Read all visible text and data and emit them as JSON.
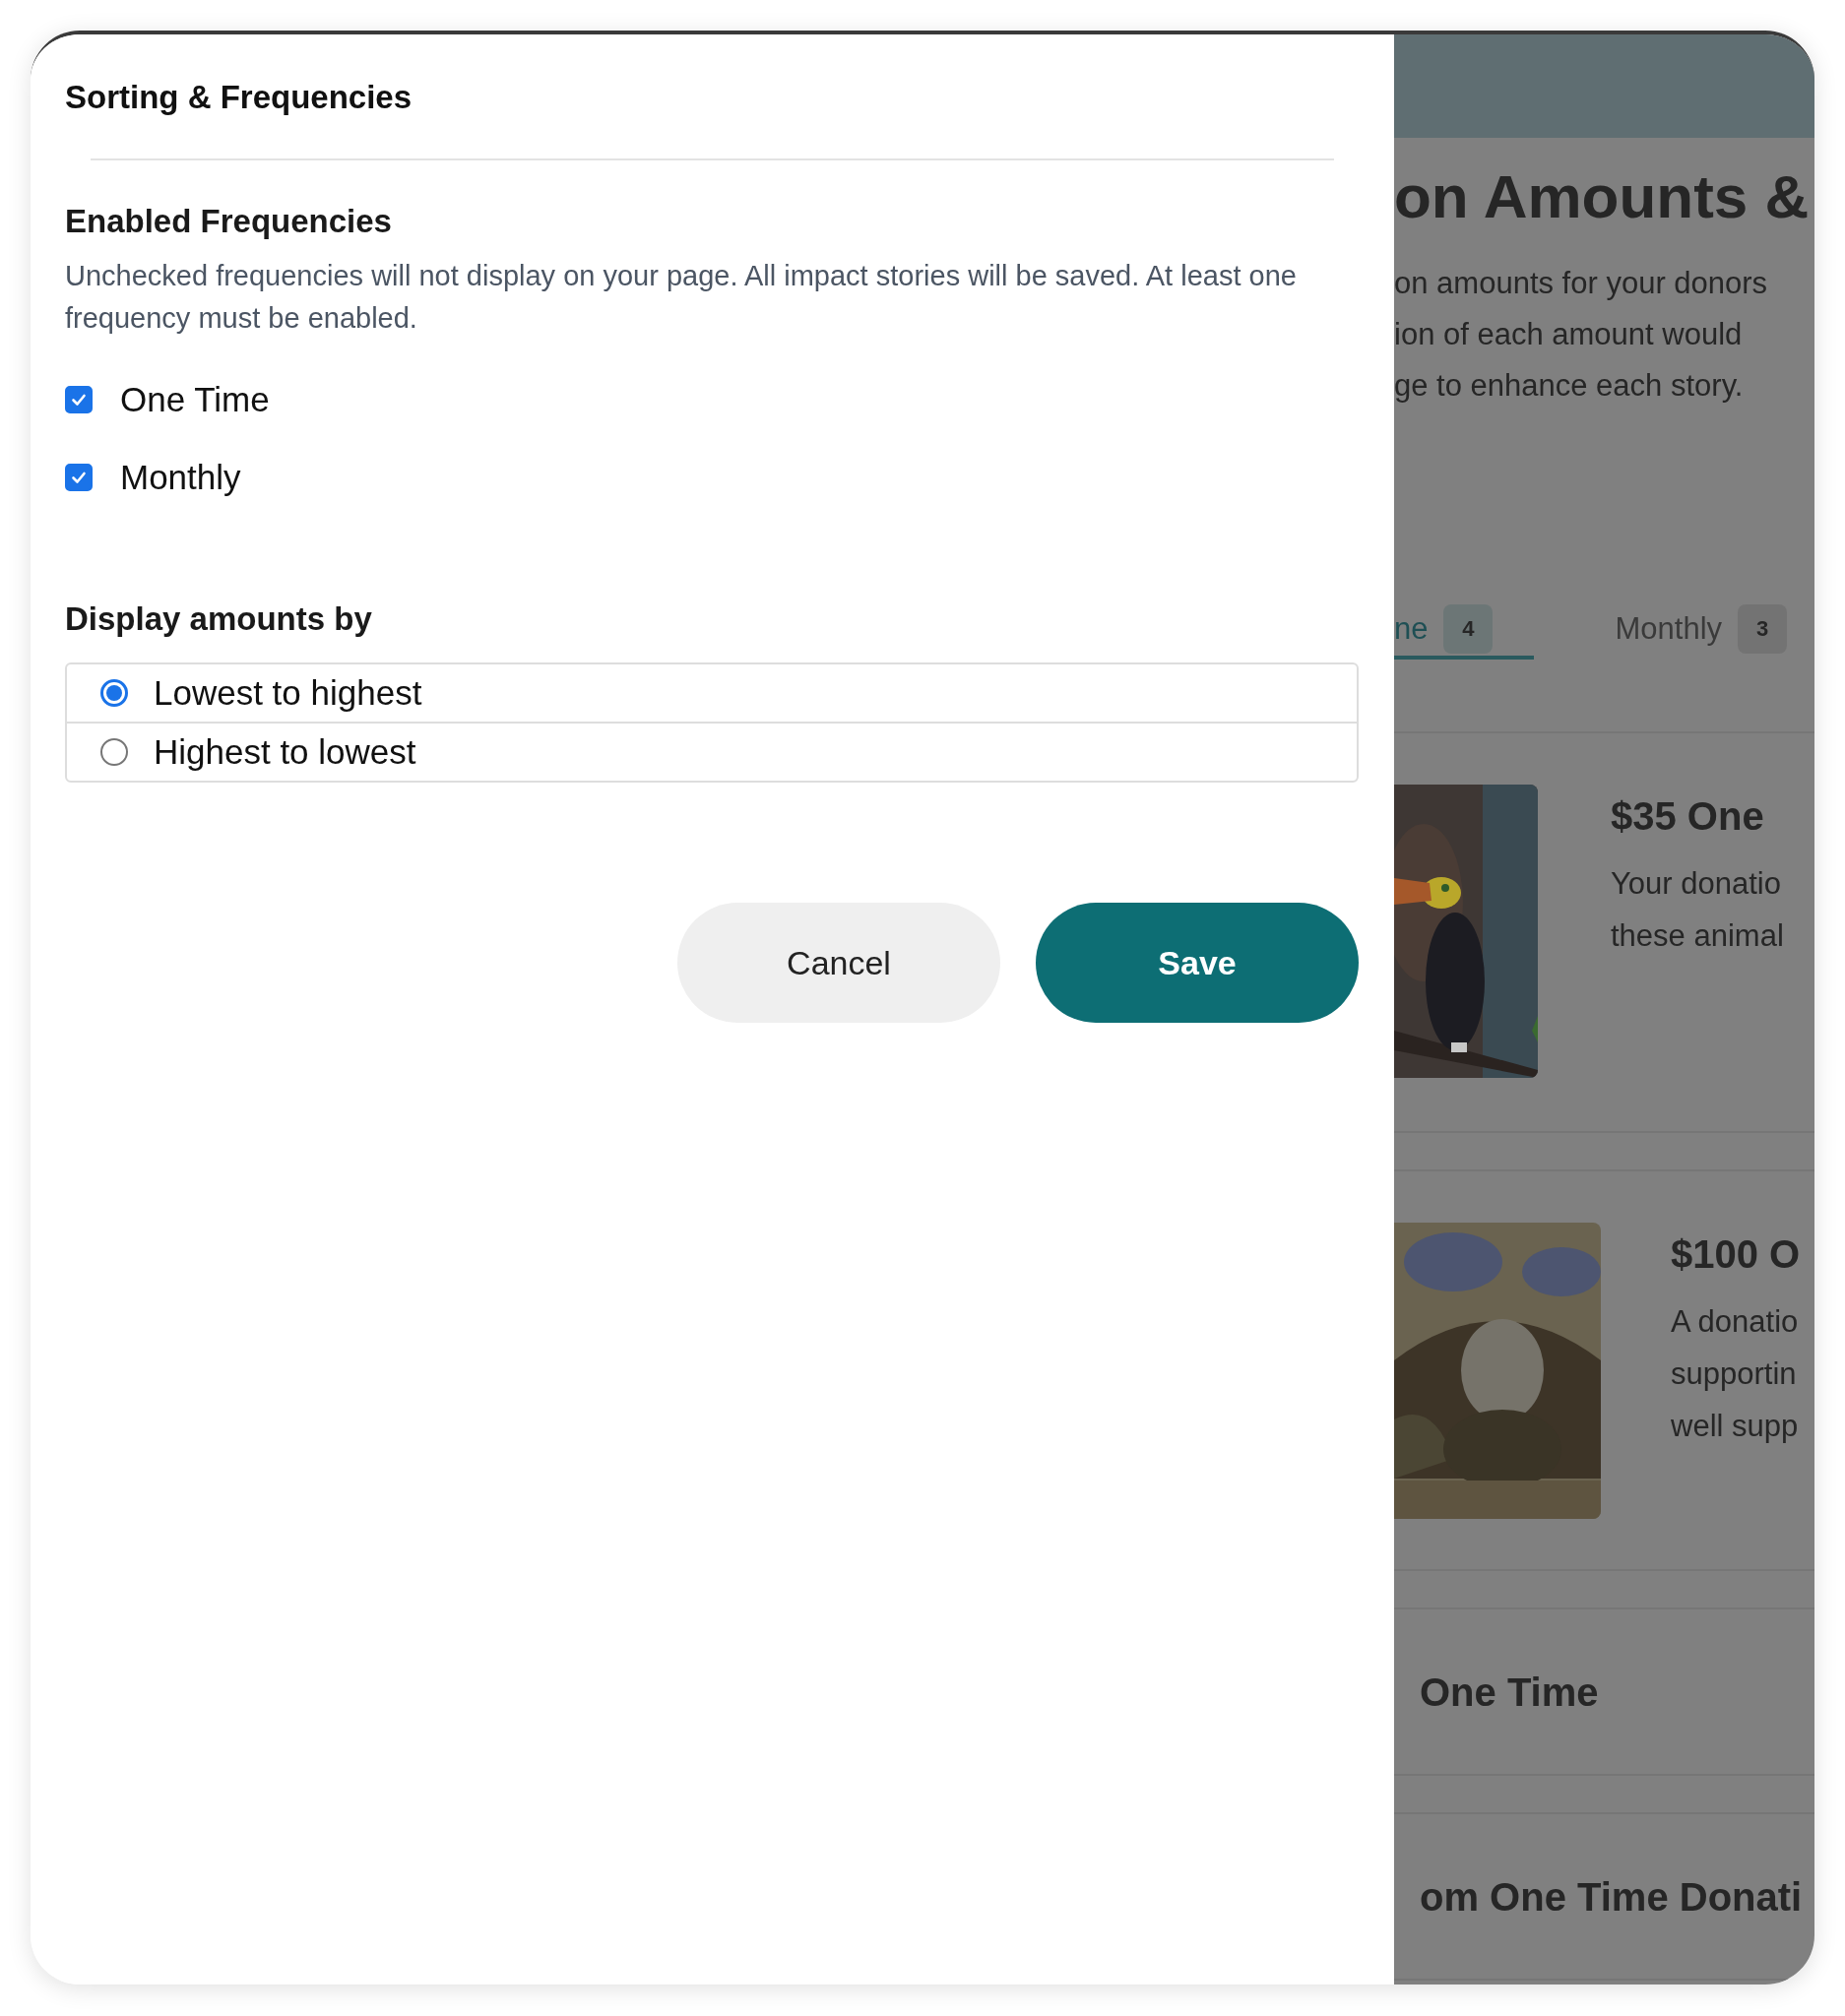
{
  "dialog": {
    "title": "Sorting & Frequencies",
    "frequencies": {
      "heading": "Enabled Frequencies",
      "description": "Unchecked frequencies will not display on your page. All impact stories will be saved. At least one frequency must be enabled.",
      "options": [
        {
          "label": "One Time",
          "checked": true
        },
        {
          "label": "Monthly",
          "checked": true
        }
      ]
    },
    "sorting": {
      "heading": "Display amounts by",
      "options": [
        {
          "label": "Lowest to highest",
          "selected": true
        },
        {
          "label": "Highest to lowest",
          "selected": false
        }
      ]
    },
    "buttons": [
      {
        "label": "Cancel",
        "kind": "secondary"
      },
      {
        "label": "Save",
        "kind": "primary"
      }
    ]
  },
  "background_page": {
    "heading": "on Amounts &",
    "description_lines": [
      "on amounts for your donors",
      "ion of each amount would",
      "ge to enhance each story."
    ],
    "tabs": [
      {
        "label": "ne",
        "count": "4",
        "selected": true
      },
      {
        "label": "Monthly",
        "count": "3",
        "selected": false
      }
    ],
    "cards": [
      {
        "title": "$35 One",
        "body_lines": [
          "Your donatio",
          "these animal"
        ],
        "picture": {
          "kind": "picture"
        }
      },
      {
        "title": "$100 O",
        "body_lines": [
          "A donatio",
          "supportin",
          "well supp"
        ],
        "picture": {
          "kind": "picture"
        }
      },
      {
        "title": "One Time"
      },
      {
        "title": "om One Time Donati"
      }
    ]
  }
}
